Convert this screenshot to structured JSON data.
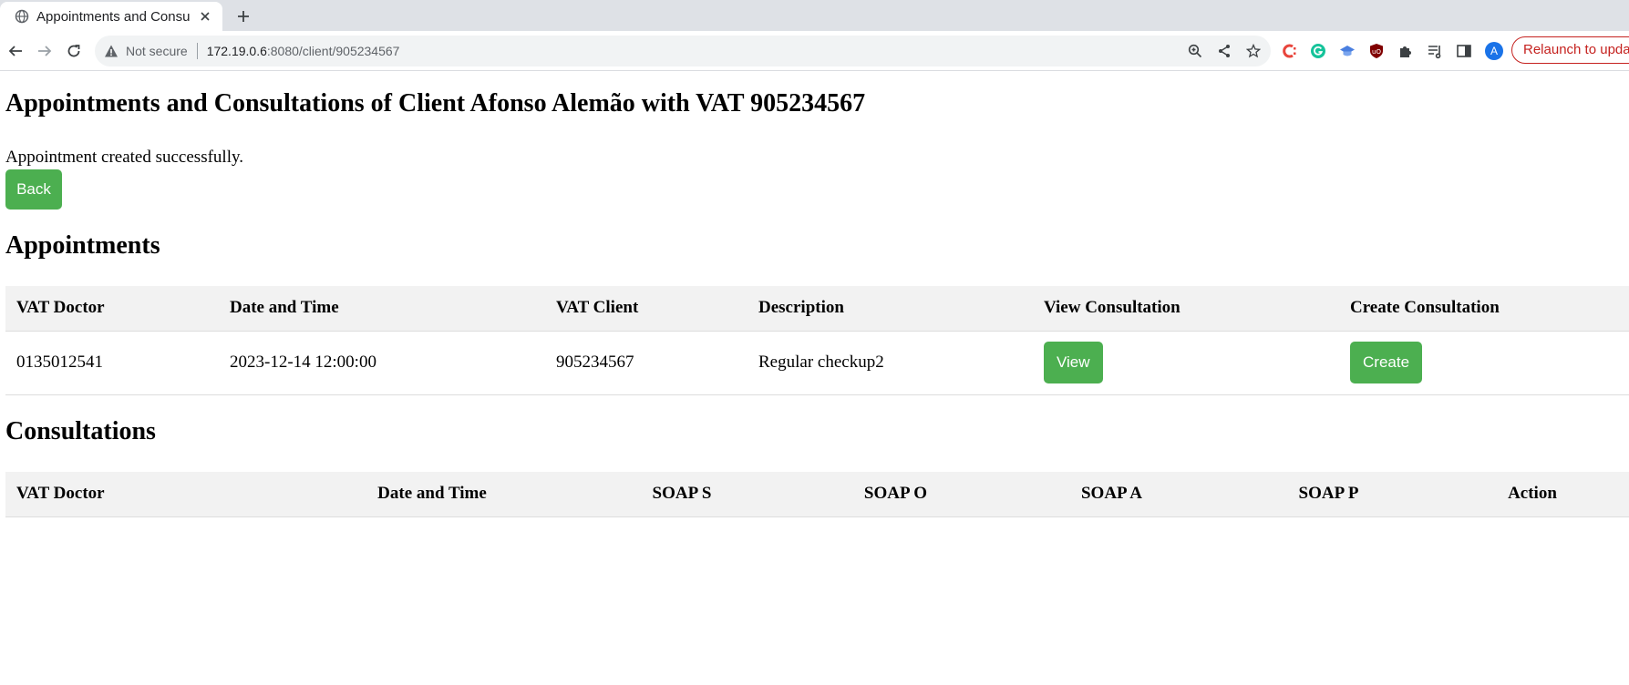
{
  "browser": {
    "tab_title": "Appointments and Consu",
    "not_secure": "Not secure",
    "url_host": "172.19.0.6",
    "url_rest": ":8080/client/905234567",
    "profile_initial": "A",
    "relaunch_label": "Relaunch to upda"
  },
  "page": {
    "title": "Appointments and Consultations of Client Afonso Alemão with VAT 905234567",
    "message": "Appointment created successfully.",
    "back_label": "Back"
  },
  "appointments": {
    "heading": "Appointments",
    "columns": [
      "VAT Doctor",
      "Date and Time",
      "VAT Client",
      "Description",
      "View Consultation",
      "Create Consultation"
    ],
    "rows": [
      {
        "vat_doctor": "0135012541",
        "date_time": "2023-12-14 12:00:00",
        "vat_client": "905234567",
        "description": "Regular checkup2",
        "view_label": "View",
        "create_label": "Create"
      }
    ]
  },
  "consultations": {
    "heading": "Consultations",
    "columns": [
      "VAT Doctor",
      "Date and Time",
      "SOAP S",
      "SOAP O",
      "SOAP A",
      "SOAP P",
      "Action"
    ]
  },
  "colors": {
    "button_green": "#4caf50",
    "header_row": "#f2f2f2",
    "relaunch_red": "#c5221f"
  }
}
